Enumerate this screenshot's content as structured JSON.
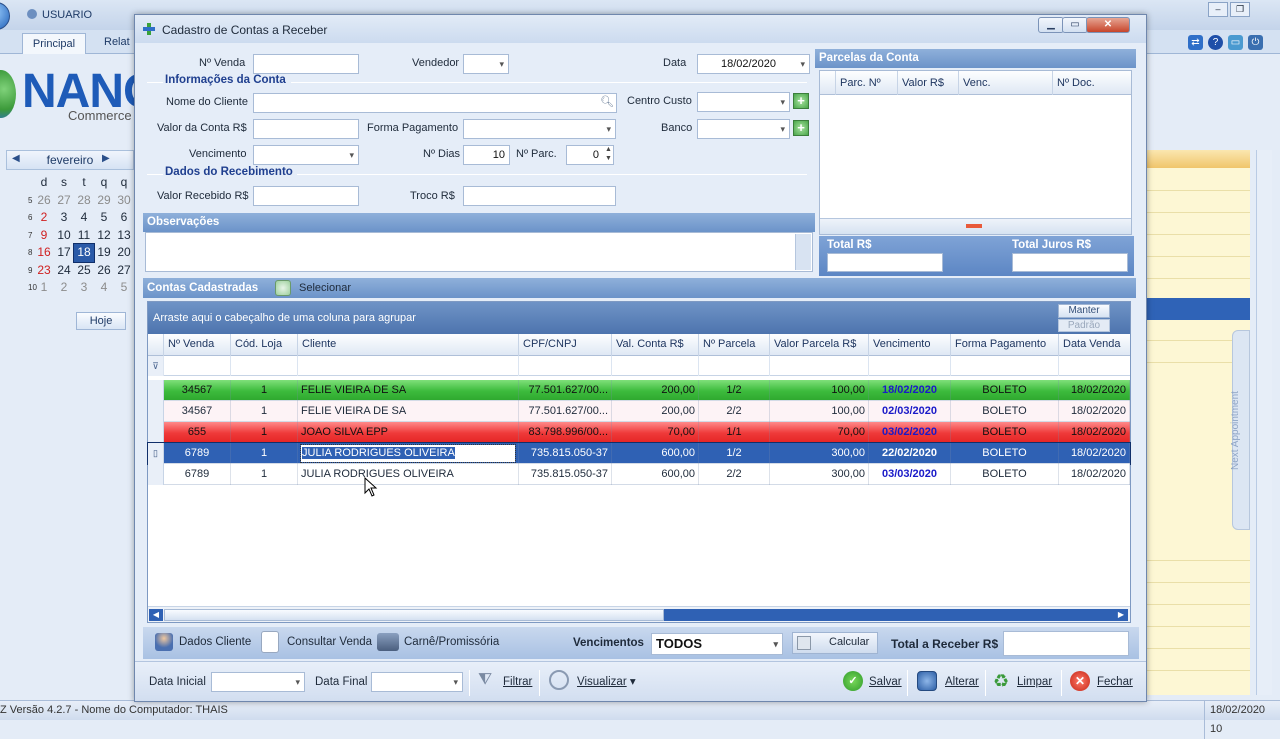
{
  "background": {
    "app_title": "USUARIO",
    "tabs": [
      "Principal",
      "Relat"
    ],
    "logo_text": "NANO",
    "logo_sub": "Commerce",
    "calendar": {
      "month": "fevereiro",
      "weekdays": [
        "d",
        "s",
        "t",
        "q",
        "q"
      ],
      "weeks": [
        {
          "wk": "5",
          "days": [
            "26",
            "27",
            "28",
            "29",
            "30"
          ]
        },
        {
          "wk": "6",
          "days": [
            "2",
            "3",
            "4",
            "5",
            "6"
          ]
        },
        {
          "wk": "7",
          "days": [
            "9",
            "10",
            "11",
            "12",
            "13"
          ]
        },
        {
          "wk": "8",
          "days": [
            "16",
            "17",
            "18",
            "19",
            "20"
          ]
        },
        {
          "wk": "9",
          "days": [
            "23",
            "24",
            "25",
            "26",
            "27"
          ]
        },
        {
          "wk": "10",
          "days": [
            "1",
            "2",
            "3",
            "4",
            "5"
          ]
        }
      ],
      "selected_day": "18",
      "today_label": "Hoje"
    },
    "next_appointment": "Next Appointment",
    "status_text": "Z  Versão 4.2.7  - Nome do Computador: THAIS",
    "status_date": "18/02/2020 10"
  },
  "dialog": {
    "title": "Cadastro de Contas a Receber",
    "form": {
      "num_venda_label": "Nº Venda",
      "num_venda_value": "",
      "vendedor_label": "Vendedor",
      "vendedor_value": "",
      "data_label": "Data",
      "data_value": "18/02/2020",
      "info_section": "Informações da Conta",
      "nome_cliente_label": "Nome do Cliente",
      "nome_cliente_value": "",
      "centro_custo_label": "Centro Custo",
      "centro_custo_value": "",
      "valor_conta_label": "Valor da Conta R$",
      "valor_conta_value": "",
      "forma_pagamento_label": "Forma Pagamento",
      "forma_pagamento_value": "",
      "banco_label": "Banco",
      "banco_value": "",
      "vencimento_label": "Vencimento",
      "vencimento_value": "",
      "num_dias_label": "Nº Dias",
      "num_dias_value": "10",
      "num_parc_label": "Nº Parc.",
      "num_parc_value": "0",
      "receb_section": "Dados do Recebimento",
      "valor_recebido_label": "Valor Recebido R$",
      "valor_recebido_value": "",
      "troco_label": "Troco R$",
      "troco_value": ""
    },
    "parcelas": {
      "title": "Parcelas da Conta",
      "columns": [
        "Parc. Nº",
        "Valor R$",
        "Venc.",
        "Nº Doc."
      ],
      "total_label": "Total R$",
      "total_value": "",
      "total_juros_label": "Total Juros R$",
      "total_juros_value": ""
    },
    "observacoes": {
      "title": "Observações",
      "value": ""
    },
    "contas": {
      "title": "Contas Cadastradas",
      "select_label": "Selecionar",
      "group_hint": "Arraste aqui o cabeçalho de uma coluna para agrupar",
      "manter_label": "Manter",
      "padrao_label": "Padrão",
      "columns": [
        "Nº Venda",
        "Cód. Loja",
        "Cliente",
        "CPF/CNPJ",
        "Val. Conta R$",
        "Nº Parcela",
        "Valor Parcela R$",
        "Vencimento",
        "Forma Pagamento",
        "Data Venda"
      ],
      "rows": [
        {
          "style": "green",
          "venda": "34567",
          "loja": "1",
          "cliente": "FELIE VIEIRA DE SA",
          "cpf": "77.501.627/00...",
          "val_conta": "200,00",
          "parcela": "1/2",
          "val_parcela": "100,00",
          "vencimento": "18/02/2020",
          "forma": "BOLETO",
          "data_venda": "18/02/2020",
          "venc_color": "#1a1ac8"
        },
        {
          "style": "pink",
          "venda": "34567",
          "loja": "1",
          "cliente": "FELIE VIEIRA DE SA",
          "cpf": "77.501.627/00...",
          "val_conta": "200,00",
          "parcela": "2/2",
          "val_parcela": "100,00",
          "vencimento": "02/03/2020",
          "forma": "BOLETO",
          "data_venda": "18/02/2020",
          "venc_color": "#1a1ac8"
        },
        {
          "style": "red",
          "venda": "655",
          "loja": "1",
          "cliente": "JOAO SILVA EPP",
          "cpf": "83.798.996/00...",
          "val_conta": "70,00",
          "parcela": "1/1",
          "val_parcela": "70,00",
          "vencimento": "03/02/2020",
          "forma": "BOLETO",
          "data_venda": "18/02/2020",
          "venc_color": "#1a1ac8"
        },
        {
          "style": "sel",
          "venda": "6789",
          "loja": "1",
          "cliente": "JULIA RODRIGUES OLIVEIRA",
          "cpf": "735.815.050-37",
          "val_conta": "600,00",
          "parcela": "1/2",
          "val_parcela": "300,00",
          "vencimento": "22/02/2020",
          "forma": "BOLETO",
          "data_venda": "18/02/2020",
          "venc_color": "#ffffff"
        },
        {
          "style": "white",
          "venda": "6789",
          "loja": "1",
          "cliente": "JULIA RODRIGUES OLIVEIRA",
          "cpf": "735.815.050-37",
          "val_conta": "600,00",
          "parcela": "2/2",
          "val_parcela": "300,00",
          "vencimento": "03/03/2020",
          "forma": "BOLETO",
          "data_venda": "18/02/2020",
          "venc_color": "#1a1ac8"
        }
      ]
    },
    "toolbar1": {
      "dados_cliente": "Dados Cliente",
      "consultar_venda": "Consultar Venda",
      "carne": "Carnê/Promissória",
      "vencimentos_label": "Vencimentos",
      "vencimentos_value": "TODOS",
      "calcular": "Calcular",
      "total_receber_label": "Total a Receber R$",
      "total_receber_value": ""
    },
    "toolbar2": {
      "data_inicial_label": "Data Inicial",
      "data_inicial_value": "",
      "data_final_label": "Data Final",
      "data_final_value": "",
      "filtrar": "Filtrar",
      "visualizar": "Visualizar",
      "salvar": "Salvar",
      "alterar": "Alterar",
      "limpar": "Limpar",
      "fechar": "Fechar"
    }
  },
  "colors": {
    "accent": "#2f61b4",
    "green_row": "#3dbb3d",
    "red_row": "#ef3a3a",
    "panel_head": "#7b9fd1"
  }
}
